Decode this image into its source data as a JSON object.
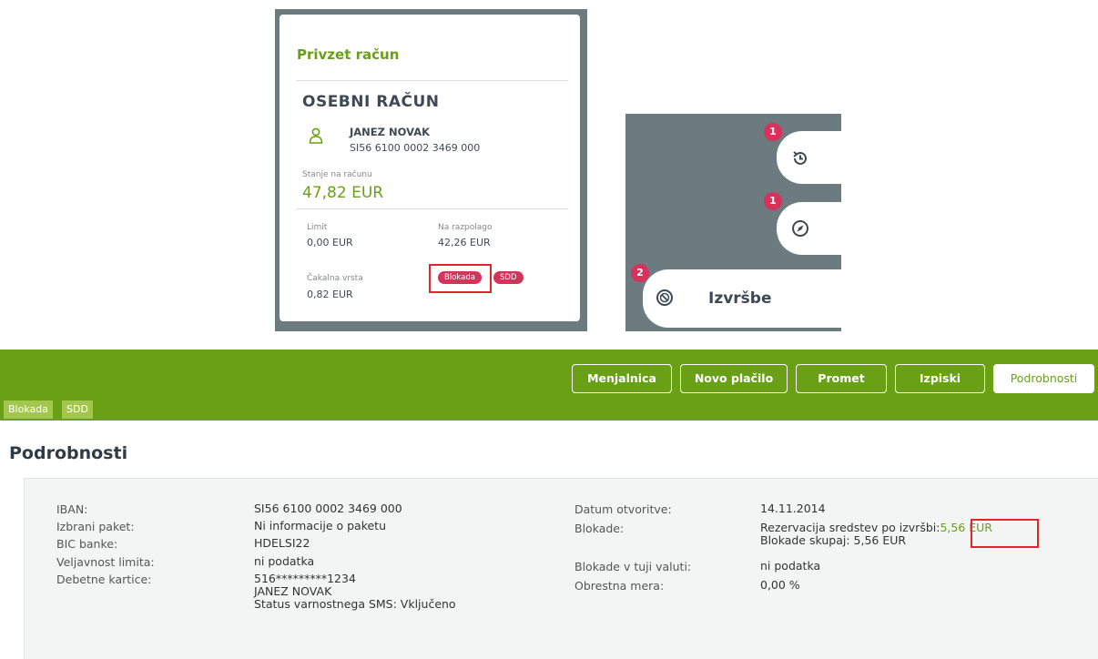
{
  "account_card": {
    "title": "Privzet račun",
    "account_type": "OSEBNI RAČUN",
    "holder": "JANEZ NOVAK",
    "iban": "SI56 6100 0002 3469 000",
    "balance_label": "Stanje na računu",
    "balance": "47,82 EUR",
    "limit_label": "Limit",
    "limit_value": "0,00 EUR",
    "available_label": "Na razpolago",
    "available_value": "42,26 EUR",
    "pending_label": "Čakalna vrsta",
    "pending_value": "0,82 EUR",
    "tags": [
      "Blokada",
      "SDD"
    ]
  },
  "side_nav": {
    "items": [
      {
        "badge": "1",
        "icon": "history-icon",
        "label": ""
      },
      {
        "badge": "1",
        "icon": "compass-icon",
        "label": ""
      },
      {
        "badge": "2",
        "icon": "blocked-icon",
        "label": "Izvršbe"
      }
    ]
  },
  "toolbar": {
    "buttons": [
      "Menjalnica",
      "Novo plačilo",
      "Promet",
      "Izpiski",
      "Podrobnosti"
    ],
    "active": "Podrobnosti",
    "tags": [
      "Blokada",
      "SDD"
    ]
  },
  "details": {
    "title": "Podrobnosti",
    "left": [
      {
        "label": "IBAN:",
        "value": "SI56 6100 0002 3469 000"
      },
      {
        "label": "Izbrani paket:",
        "value": "Ni informacije o paketu"
      },
      {
        "label": "BIC banke:",
        "value": "HDELSI22"
      },
      {
        "label": "Veljavnost limita:",
        "value": "ni podatka"
      },
      {
        "label": "Debetne kartice:",
        "value": "516*********1234",
        "extra": [
          "JANEZ NOVAK",
          "Status varnostnega SMS: Vključeno"
        ]
      }
    ],
    "right": [
      {
        "label": "Datum otvoritve:",
        "value": "14.11.2014"
      },
      {
        "label": "Blokade:",
        "value_prefix": "Rezervacija sredstev po izvršbi:",
        "value_link": "5,56 EUR",
        "value_line2": "Blokade skupaj: 5,56 EUR"
      },
      {
        "label": "Blokade v tuji valuti:",
        "value": "ni podatka"
      },
      {
        "label": "Obrestna mera:",
        "value": "0,00 %"
      }
    ]
  },
  "colors": {
    "brand_green": "#6aa016",
    "badge_red": "#d7325b",
    "highlight_red": "#e0252f"
  }
}
